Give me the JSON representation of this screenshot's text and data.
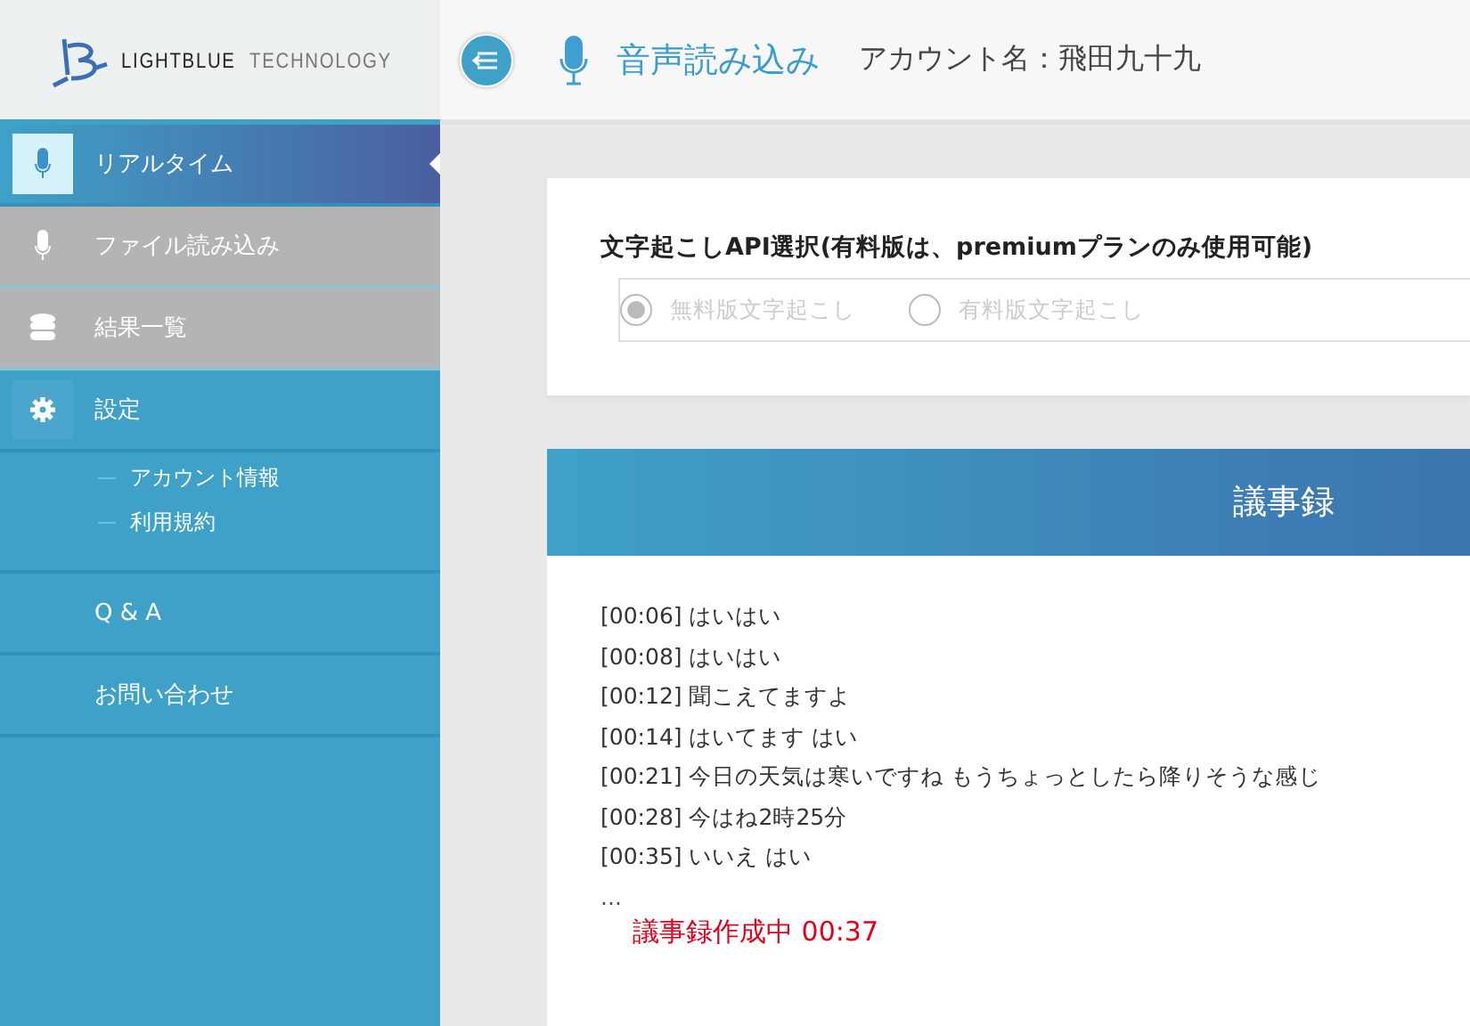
{
  "logo": {
    "brand": "LIGHTBLUE",
    "suffix": "TECHNOLOGY"
  },
  "header": {
    "title": "音声読み込み",
    "account": "アカウント名：飛田九十九"
  },
  "sidebar": {
    "items": [
      {
        "label": "リアルタイム",
        "selected": true,
        "disabled": false
      },
      {
        "label": "ファイル読み込み",
        "selected": false,
        "disabled": true
      },
      {
        "label": "結果一覧",
        "selected": false,
        "disabled": true
      },
      {
        "label": "設定",
        "selected": false,
        "disabled": false,
        "children": [
          {
            "label": "アカウント情報"
          },
          {
            "label": "利用規約"
          }
        ]
      },
      {
        "label": "Q & A",
        "selected": false,
        "disabled": false
      },
      {
        "label": "お問い合わせ",
        "selected": false,
        "disabled": false
      }
    ]
  },
  "api_select": {
    "label": "文字起こしAPI選択(有料版は、premiumプランのみ使用可能)",
    "disabled": true,
    "options": [
      {
        "label": "無料版文字起こし",
        "selected": true
      },
      {
        "label": "有料版文字起こし",
        "selected": false
      }
    ]
  },
  "minutes": {
    "title": "議事録",
    "lines": [
      "[00:06] はいはい",
      "[00:08] はいはい",
      "[00:12] 聞こえてますよ",
      "[00:14] はいてます はい",
      "[00:21] 今日の天気は寒いですね もうちょっとしたら降りそうな感じ",
      "[00:28] 今はね2時25分",
      "[00:35] いいえ はい"
    ],
    "ellipsis": "...",
    "status": {
      "label": "議事録作成中",
      "time": "00:37"
    }
  }
}
